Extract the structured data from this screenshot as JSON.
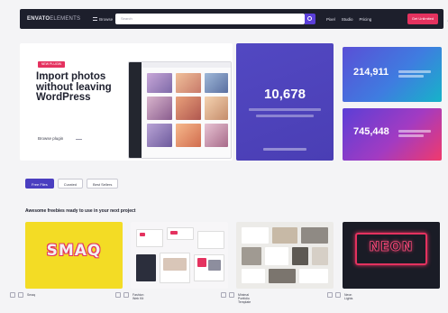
{
  "topbar": {
    "logo_bold": "ENVATO",
    "logo_thin": "ELEMENTS",
    "browse_label": "Browse",
    "search_placeholder": "Search",
    "nav_links": [
      "Pixel",
      "Studio",
      "Pricing"
    ],
    "cta_label": "Get Unlimited"
  },
  "hero": {
    "badge": "NEW PLUGIN",
    "title": "Import photos without leaving WordPress",
    "link": "Browse plugin"
  },
  "stats": {
    "stat1_value": "10,678",
    "stat2_value": "214,911",
    "stat3_value": "745,448"
  },
  "tabs": {
    "items": [
      "Free Files",
      "Curated",
      "Best Sellers"
    ],
    "active_index": 0
  },
  "section": {
    "title": "Awesome freebies ready to use in your next project"
  },
  "cards": [
    {
      "thumb_text": "SMAQ",
      "title": "Smaq"
    },
    {
      "thumb_text": "",
      "title": "Fashion Web Kit"
    },
    {
      "thumb_text": "",
      "title": "Minimal Portfolio Template"
    },
    {
      "thumb_text": "NEON",
      "title": "Neon Lights"
    }
  ],
  "colors": {
    "accent": "#5b3fd9",
    "cta": "#e4325f",
    "topbar": "#1d1f2c"
  }
}
